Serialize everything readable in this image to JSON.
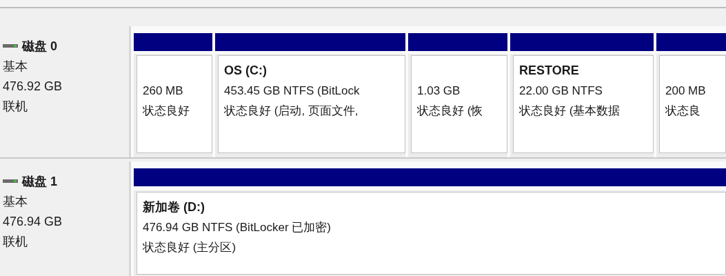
{
  "disks": [
    {
      "name": "磁盘 0",
      "type": "基本",
      "size": "476.92 GB",
      "status": "联机",
      "partitions": [
        {
          "lines": [
            "260 MB",
            "状态良好"
          ]
        },
        {
          "name": "OS  (C:)",
          "lines": [
            "453.45 GB NTFS (BitLock",
            "状态良好 (启动, 页面文件,"
          ]
        },
        {
          "lines": [
            "1.03 GB",
            "状态良好 (恢"
          ]
        },
        {
          "name": "RESTORE",
          "lines": [
            "22.00 GB NTFS",
            "状态良好 (基本数据"
          ]
        },
        {
          "lines": [
            "200 MB",
            "状态良"
          ]
        }
      ]
    },
    {
      "name": "磁盘 1",
      "type": "基本",
      "size": "476.94 GB",
      "status": "联机",
      "partitions": [
        {
          "name": "新加卷  (D:)",
          "lines": [
            "476.94 GB NTFS (BitLocker 已加密)",
            "状态良好 (主分区)"
          ]
        }
      ]
    }
  ]
}
